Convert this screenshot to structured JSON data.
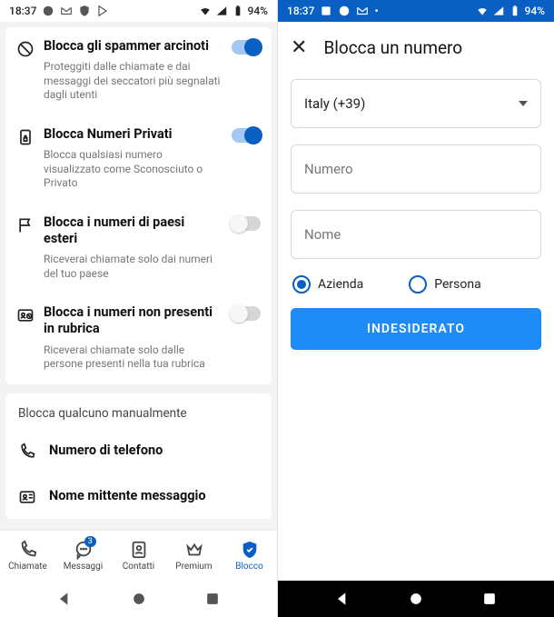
{
  "status": {
    "time": "18:37",
    "battery": "94%"
  },
  "left": {
    "settings": [
      {
        "title": "Blocca gli spammer arcinoti",
        "desc": "Proteggiti dalle chiamate e dai messaggi dei seccatori più segnalati dagli utenti",
        "on": true,
        "icon": "block"
      },
      {
        "title": "Blocca Numeri Privati",
        "desc": "Blocca qualsiasi numero visualizzato come Sconosciuto o Privato",
        "on": true,
        "icon": "phone-lock"
      },
      {
        "title": "Blocca i numeri di paesi esteri",
        "desc": "Riceverai chiamate solo dai numeri del tuo paese",
        "on": false,
        "icon": "flag"
      },
      {
        "title": "Blocca i numeri non presenti in rubrica",
        "desc": "Riceverai chiamate solo dalle persone presenti nella tua rubrica",
        "on": false,
        "icon": "contact-block"
      }
    ],
    "manual_header": "Blocca qualcuno manualmente",
    "manual_items": [
      {
        "label": "Numero di telefono",
        "icon": "phone"
      },
      {
        "label": "Nome mittente messaggio",
        "icon": "sender"
      }
    ],
    "nav": {
      "items": [
        {
          "label": "Chiamate",
          "icon": "calls"
        },
        {
          "label": "Messaggi",
          "icon": "messages",
          "badge": "3"
        },
        {
          "label": "Contatti",
          "icon": "contacts"
        },
        {
          "label": "Premium",
          "icon": "premium"
        },
        {
          "label": "Blocco",
          "icon": "block",
          "active": true
        }
      ]
    }
  },
  "right": {
    "title": "Blocca un numero",
    "country": "Italy (+39)",
    "number_placeholder": "Numero",
    "name_placeholder": "Nome",
    "radio_company": "Azienda",
    "radio_person": "Persona",
    "button": "INDESIDERATO"
  }
}
